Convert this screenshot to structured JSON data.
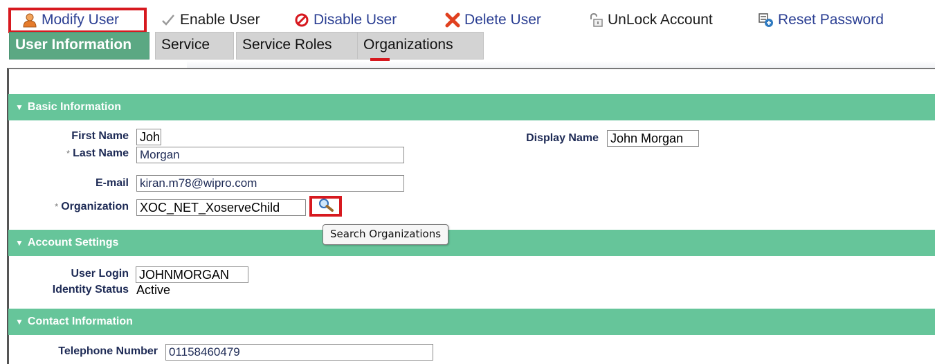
{
  "toolbar": {
    "modify_user": "Modify User",
    "enable_user": "Enable User",
    "disable_user": "Disable User",
    "delete_user": "Delete User",
    "unlock_account": "UnLock Account",
    "reset_password": "Reset Password"
  },
  "tabs": [
    {
      "label": "User Information",
      "active": true
    },
    {
      "label": "Service",
      "active": false
    },
    {
      "label": "Service Roles",
      "active": false
    },
    {
      "label": "Organizations",
      "active": false
    }
  ],
  "sections": {
    "basic": {
      "title": "Basic Information",
      "first_name_label": "First Name",
      "first_name_value": "John",
      "last_name_label": "Last Name",
      "last_name_value": "Morgan",
      "email_label": "E-mail",
      "email_value": "kiran.m78@wipro.com",
      "organization_label": "Organization",
      "organization_value": "XOC_NET_XoserveChild",
      "display_name_label": "Display Name",
      "display_name_value": "John Morgan",
      "required_marker": "*"
    },
    "account": {
      "title": "Account Settings",
      "user_login_label": "User Login",
      "user_login_value": "JOHNMORGAN",
      "identity_status_label": "Identity Status",
      "identity_status_value": "Active"
    },
    "contact": {
      "title": "Contact Information",
      "telephone_label": "Telephone Number",
      "telephone_value": "01158460479"
    }
  },
  "tooltip": {
    "search_organizations": "Search Organizations"
  },
  "colors": {
    "section_header": "#66c59a",
    "active_tab": "#5ba883",
    "inactive_tab": "#d3d3d3",
    "highlight": "#d7191f",
    "link": "#2b3f93"
  },
  "icons": {
    "modify_user": "user-icon",
    "enable_user": "check-icon",
    "disable_user": "prohibited-icon",
    "delete_user": "x-icon",
    "unlock_account": "unlock-icon",
    "reset_password": "reset-password-icon",
    "search": "magnifier-icon"
  }
}
